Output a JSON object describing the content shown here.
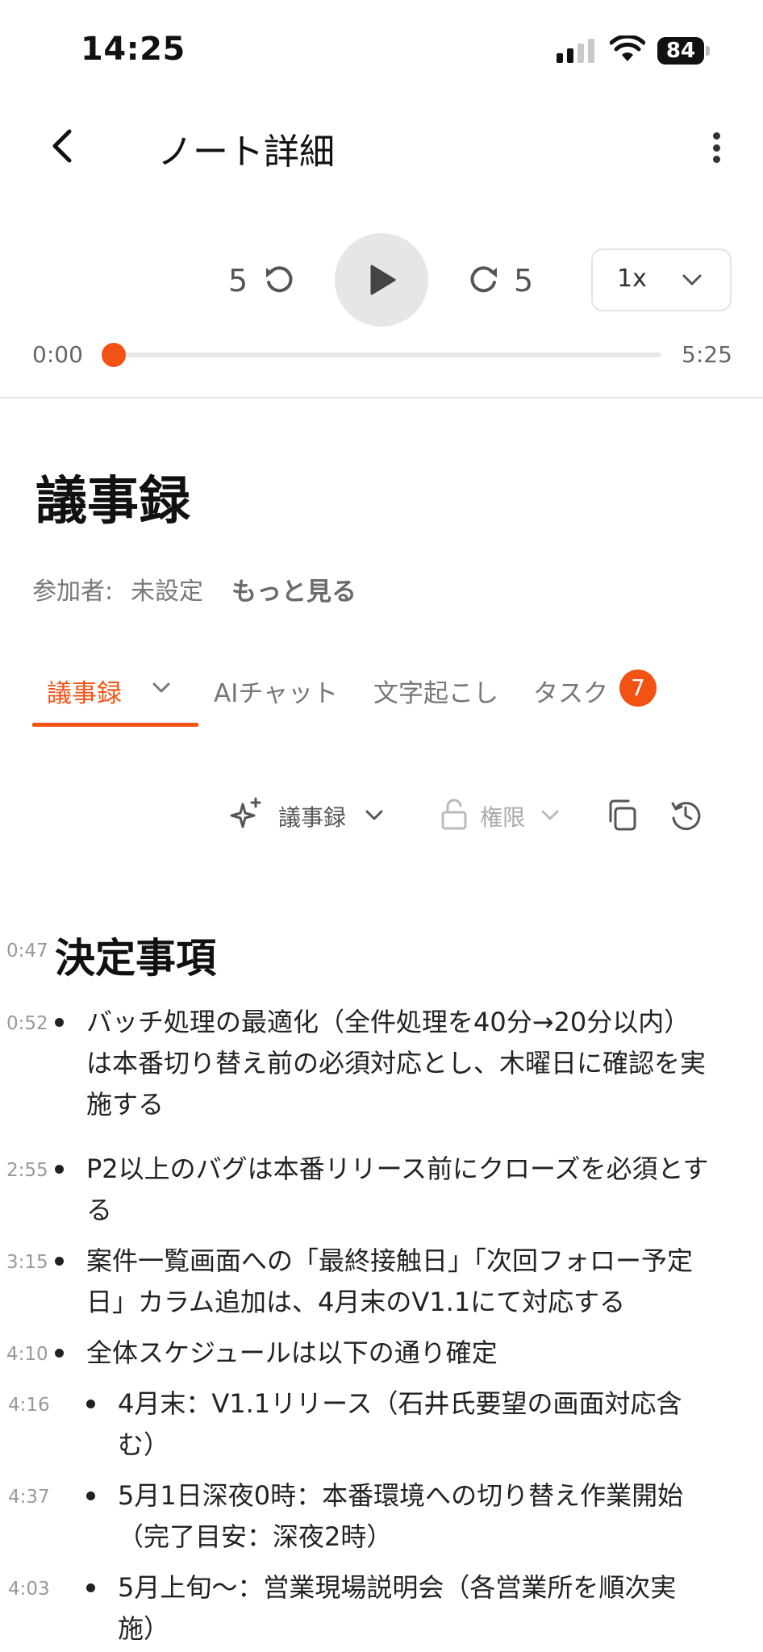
{
  "status_bar": {
    "time": "14:25",
    "battery": "84"
  },
  "header": {
    "title": "ノート詳細"
  },
  "player": {
    "rewind_seconds": "5",
    "forward_seconds": "5",
    "speed": "1x",
    "current_time": "0:00",
    "total_time": "5:25",
    "progress": 0
  },
  "note": {
    "title": "議事録",
    "participants_label": "参加者:",
    "participants_value": "未設定",
    "see_more": "もっと見る"
  },
  "tabs": [
    {
      "label": "議事録",
      "active": true
    },
    {
      "label": "AIチャット",
      "active": false
    },
    {
      "label": "文字起こし",
      "active": false
    },
    {
      "label": "タスク",
      "active": false,
      "badge": "7"
    }
  ],
  "toolbar": {
    "template_label": "議事録",
    "permission_label": "権限"
  },
  "content": {
    "section": {
      "timestamp": "0:47",
      "title": "決定事項"
    },
    "items": [
      {
        "timestamp": "0:52",
        "level": 1,
        "text": "バッチ処理の最適化（全件処理を40分→20分以内）は本番切り替え前の必須対応とし、木曜日に確認を実施する"
      },
      {
        "timestamp": "2:55",
        "level": 1,
        "text": "P2以上のバグは本番リリース前にクローズを必須とする"
      },
      {
        "timestamp": "3:15",
        "level": 1,
        "text": "案件一覧画面への「最終接触日」「次回フォロー予定日」カラム追加は、4月末のV1.1にて対応する"
      },
      {
        "timestamp": "4:10",
        "level": 1,
        "text": "全体スケジュールは以下の通り確定"
      },
      {
        "timestamp": "4:16",
        "level": 2,
        "text": "4月末：V1.1リリース（石井氏要望の画面対応含む）"
      },
      {
        "timestamp": "4:37",
        "level": 2,
        "text": "5月1日深夜0時：本番環境への切り替え作業開始（完了目安：深夜2時）"
      },
      {
        "timestamp": "4:03",
        "level": 2,
        "text": "5月上旬〜：営業現場説明会（各営業所を順次実施）"
      }
    ]
  },
  "colors": {
    "accent": "#f25314",
    "text": "#222222",
    "muted": "#777777"
  }
}
